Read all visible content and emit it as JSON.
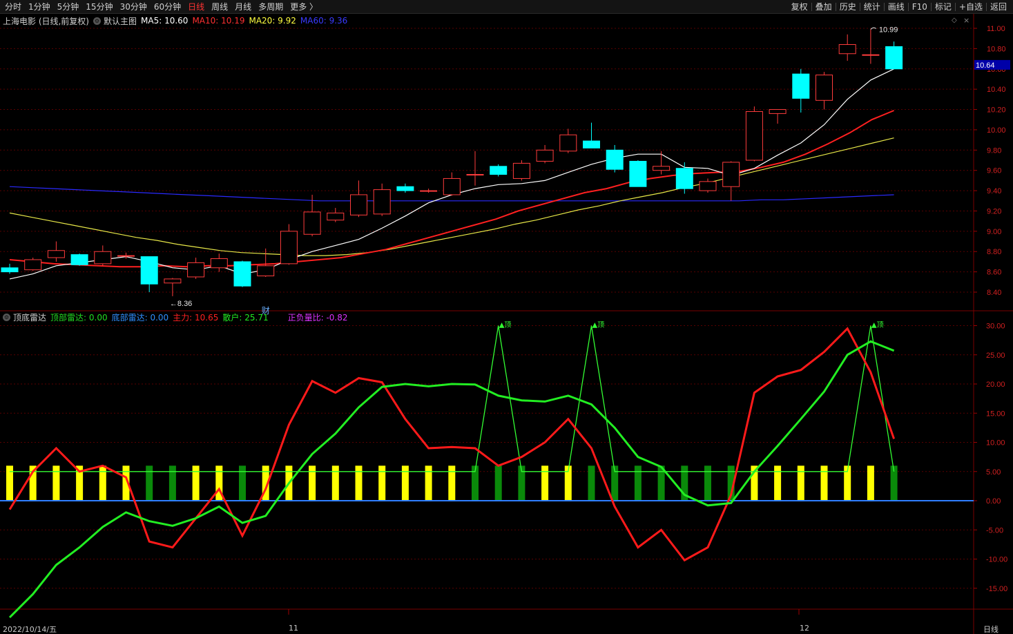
{
  "toolbar": {
    "left": [
      "分时",
      "1分钟",
      "5分钟",
      "15分钟",
      "30分钟",
      "60分钟",
      "日线",
      "周线",
      "月线",
      "多周期",
      "更多 〉"
    ],
    "active": "日线",
    "right": [
      "复权",
      "叠加",
      "历史",
      "统计",
      "画线",
      "F10",
      "标记",
      "+自选",
      "返回"
    ]
  },
  "main": {
    "stock": "上海电影 (日线,前复权)",
    "template_icon": "gear-icon",
    "template": "默认主图",
    "ma5": "MA5: 10.60",
    "ma10": "MA10: 10.19",
    "ma20": "MA20: 9.92",
    "ma60": "MA60: 9.36",
    "current_price": "10.64",
    "high_label": "10.99",
    "low_label": "8.36",
    "event_mark": "财",
    "y_ticks": [
      "11.00",
      "10.80",
      "10.60",
      "10.40",
      "10.20",
      "10.00",
      "9.80",
      "9.60",
      "9.40",
      "9.20",
      "9.00",
      "8.80",
      "8.60",
      "8.40"
    ]
  },
  "sub": {
    "name": "顶底雷达",
    "top_radar": "顶部雷达: 0.00",
    "bottom_radar": "底部雷达: 0.00",
    "main_force": "主力: 10.65",
    "retail": "散户: 25.71",
    "ratio": "正负量比: -0.82",
    "signal_label": "顶",
    "y_ticks": [
      "30.00",
      "25.00",
      "20.00",
      "15.00",
      "10.00",
      "5.00",
      "0.00",
      "-5.00",
      "-10.00",
      "-15.00"
    ]
  },
  "footer": {
    "date": "2022/10/14/五",
    "month_11": "11",
    "month_12": "12",
    "period": "日线"
  },
  "colors": {
    "up": "#ff3c3c",
    "down": "#00ffff",
    "ma5": "#ffffff",
    "ma10": "#ff2020",
    "ma20": "#e8e848",
    "ma60": "#2a2aff",
    "main_force": "#ff1a1a",
    "retail": "#22ee22",
    "yellow_bar": "#ffff00",
    "green_bar": "#0a8a0a",
    "zero_line": "#2f7fff",
    "grid": "#5a0000"
  },
  "chart_data": [
    {
      "type": "candlestick",
      "title": "上海电影 (日线,前复权)",
      "ylim": [
        8.3,
        11.1
      ],
      "candles": [
        {
          "o": 8.64,
          "h": 8.68,
          "l": 8.58,
          "c": 8.6
        },
        {
          "o": 8.62,
          "h": 8.74,
          "l": 8.61,
          "c": 8.72
        },
        {
          "o": 8.74,
          "h": 8.9,
          "l": 8.7,
          "c": 8.81
        },
        {
          "o": 8.77,
          "h": 8.78,
          "l": 8.66,
          "c": 8.67
        },
        {
          "o": 8.68,
          "h": 8.86,
          "l": 8.66,
          "c": 8.8
        },
        {
          "o": 8.76,
          "h": 8.79,
          "l": 8.73,
          "c": 8.76
        },
        {
          "o": 8.75,
          "h": 8.75,
          "l": 8.4,
          "c": 8.48
        },
        {
          "o": 8.49,
          "h": 8.54,
          "l": 8.36,
          "c": 8.53
        },
        {
          "o": 8.55,
          "h": 8.74,
          "l": 8.53,
          "c": 8.69
        },
        {
          "o": 8.64,
          "h": 8.78,
          "l": 8.6,
          "c": 8.73
        },
        {
          "o": 8.7,
          "h": 8.71,
          "l": 8.45,
          "c": 8.46
        },
        {
          "o": 8.56,
          "h": 8.83,
          "l": 8.55,
          "c": 8.66
        },
        {
          "o": 8.68,
          "h": 9.07,
          "l": 8.67,
          "c": 9.0
        },
        {
          "o": 8.97,
          "h": 9.36,
          "l": 8.95,
          "c": 9.19
        },
        {
          "o": 9.11,
          "h": 9.23,
          "l": 9.09,
          "c": 9.18
        },
        {
          "o": 9.16,
          "h": 9.5,
          "l": 9.14,
          "c": 9.36
        },
        {
          "o": 9.17,
          "h": 9.47,
          "l": 9.15,
          "c": 9.41
        },
        {
          "o": 9.44,
          "h": 9.47,
          "l": 9.38,
          "c": 9.4
        },
        {
          "o": 9.4,
          "h": 9.42,
          "l": 9.38,
          "c": 9.4
        },
        {
          "o": 9.36,
          "h": 9.58,
          "l": 9.35,
          "c": 9.52
        },
        {
          "o": 9.56,
          "h": 9.79,
          "l": 9.45,
          "c": 9.56
        },
        {
          "o": 9.64,
          "h": 9.66,
          "l": 9.54,
          "c": 9.56
        },
        {
          "o": 9.52,
          "h": 9.7,
          "l": 9.5,
          "c": 9.67
        },
        {
          "o": 9.69,
          "h": 9.85,
          "l": 9.67,
          "c": 9.8
        },
        {
          "o": 9.79,
          "h": 10.01,
          "l": 9.77,
          "c": 9.95
        },
        {
          "o": 9.89,
          "h": 10.07,
          "l": 9.82,
          "c": 9.82
        },
        {
          "o": 9.8,
          "h": 9.85,
          "l": 9.58,
          "c": 9.61
        },
        {
          "o": 9.69,
          "h": 9.7,
          "l": 9.44,
          "c": 9.44
        },
        {
          "o": 9.6,
          "h": 9.79,
          "l": 9.56,
          "c": 9.64
        },
        {
          "o": 9.62,
          "h": 9.68,
          "l": 9.37,
          "c": 9.42
        },
        {
          "o": 9.4,
          "h": 9.52,
          "l": 9.38,
          "c": 9.49
        },
        {
          "o": 9.44,
          "h": 9.69,
          "l": 9.3,
          "c": 9.68
        },
        {
          "o": 9.7,
          "h": 10.23,
          "l": 9.69,
          "c": 10.18
        },
        {
          "o": 10.16,
          "h": 10.2,
          "l": 10.06,
          "c": 10.2
        },
        {
          "o": 10.55,
          "h": 10.6,
          "l": 10.17,
          "c": 10.31
        },
        {
          "o": 10.29,
          "h": 10.57,
          "l": 10.2,
          "c": 10.54
        },
        {
          "o": 10.75,
          "h": 10.94,
          "l": 10.68,
          "c": 10.84
        },
        {
          "o": 10.74,
          "h": 10.99,
          "l": 10.65,
          "c": 10.74
        },
        {
          "o": 10.82,
          "h": 10.87,
          "l": 10.6,
          "c": 10.6
        }
      ],
      "ma5": [
        8.53,
        8.58,
        8.66,
        8.69,
        8.72,
        8.75,
        8.7,
        8.64,
        8.62,
        8.66,
        8.58,
        8.62,
        8.72,
        8.8,
        8.86,
        8.92,
        9.03,
        9.15,
        9.28,
        9.36,
        9.42,
        9.46,
        9.47,
        9.5,
        9.58,
        9.66,
        9.72,
        9.76,
        9.76,
        9.63,
        9.62,
        9.55,
        9.62,
        9.75,
        9.87,
        10.05,
        10.3,
        10.49,
        10.6
      ],
      "ma10": [
        8.72,
        8.7,
        8.68,
        8.67,
        8.66,
        8.65,
        8.65,
        8.66,
        8.65,
        8.66,
        8.66,
        8.67,
        8.68,
        8.7,
        8.72,
        8.74,
        8.78,
        8.82,
        8.88,
        8.94,
        9.0,
        9.06,
        9.12,
        9.2,
        9.26,
        9.32,
        9.38,
        9.42,
        9.48,
        9.52,
        9.55,
        9.57,
        9.58,
        9.59,
        9.63,
        9.68,
        9.76,
        9.86,
        9.97,
        10.1,
        10.19
      ],
      "ma20": [
        9.18,
        9.14,
        9.1,
        9.06,
        9.02,
        8.98,
        8.94,
        8.91,
        8.87,
        8.84,
        8.81,
        8.79,
        8.78,
        8.77,
        8.76,
        8.76,
        8.77,
        8.79,
        8.82,
        8.86,
        8.9,
        8.94,
        8.98,
        9.02,
        9.07,
        9.11,
        9.16,
        9.21,
        9.25,
        9.3,
        9.34,
        9.38,
        9.43,
        9.47,
        9.52,
        9.57,
        9.62,
        9.67,
        9.72,
        9.77,
        9.82,
        9.87,
        9.92
      ],
      "ma60": [
        9.44,
        9.43,
        9.42,
        9.41,
        9.4,
        9.39,
        9.38,
        9.37,
        9.36,
        9.35,
        9.34,
        9.33,
        9.32,
        9.31,
        9.3,
        9.3,
        9.3,
        9.3,
        9.3,
        9.3,
        9.3,
        9.3,
        9.3,
        9.3,
        9.3,
        9.3,
        9.3,
        9.3,
        9.3,
        9.3,
        9.3,
        9.3,
        9.3,
        9.3,
        9.31,
        9.31,
        9.32,
        9.33,
        9.34,
        9.35,
        9.36
      ]
    },
    {
      "type": "line",
      "title": "顶底雷达",
      "ylim": [
        -20,
        30
      ],
      "series": [
        {
          "name": "主力",
          "values": [
            -1.5,
            5,
            9,
            5,
            6,
            4,
            -7,
            -8,
            -3,
            2,
            -6,
            2,
            13,
            20.5,
            18.5,
            21,
            20.3,
            14,
            9,
            9.2,
            9,
            6,
            7.5,
            10,
            14,
            9,
            -1,
            -8,
            -5,
            -10.2,
            -8,
            1,
            18.5,
            21.3,
            22.4,
            25.5,
            29.5,
            22,
            10.6
          ]
        },
        {
          "name": "散户",
          "values": [
            -20,
            -16,
            -11,
            -8,
            -4.5,
            -2,
            -3.5,
            -4.3,
            -3,
            -1,
            -3.8,
            -2.6,
            3,
            8,
            11.5,
            16,
            19.5,
            20,
            19.6,
            20,
            19.9,
            18,
            17.2,
            17,
            18,
            16.5,
            12.5,
            7.5,
            5.8,
            1,
            -0.8,
            -0.4,
            5,
            9.4,
            14,
            18.7,
            25,
            27.3,
            25.7
          ]
        }
      ],
      "signal_values": [
        0,
        0,
        0,
        0,
        0,
        0,
        0,
        0,
        0,
        0,
        0,
        0,
        0,
        0,
        0,
        0,
        0,
        0,
        0,
        0,
        0,
        30,
        0,
        0,
        0,
        30,
        0,
        0,
        0,
        0,
        0,
        0,
        0,
        0,
        0,
        0,
        0,
        30,
        0
      ],
      "bars": [
        "y",
        "y",
        "y",
        "y",
        "y",
        "y",
        "g",
        "g",
        "y",
        "y",
        "g",
        "y",
        "y",
        "y",
        "y",
        "y",
        "y",
        "y",
        "y",
        "y",
        "g",
        "g",
        "g",
        "y",
        "y",
        "g",
        "g",
        "g",
        "g",
        "g",
        "g",
        "g",
        "y",
        "y",
        "y",
        "y",
        "y",
        "y",
        "g"
      ]
    }
  ]
}
